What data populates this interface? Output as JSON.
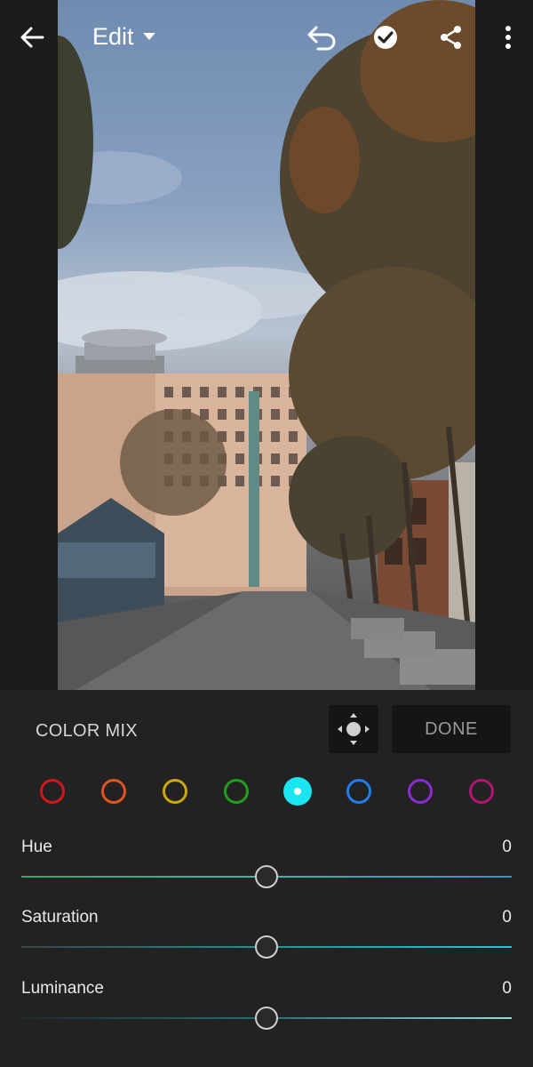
{
  "header": {
    "title": "Edit",
    "icons": {
      "back": "arrow-left-icon",
      "dropdown": "caret-down-icon",
      "undo": "undo-icon",
      "done": "checkmark-circle-icon",
      "share": "share-icon",
      "more": "more-vertical-icon"
    }
  },
  "photo": {
    "description_icon": "photo-canvas"
  },
  "panel": {
    "title": "COLOR MIX",
    "target_icon": "target-adjust-icon",
    "done_label": "DONE",
    "colors": [
      {
        "name": "red",
        "hex": "#d3161a",
        "selected": false
      },
      {
        "name": "orange",
        "hex": "#e2531e",
        "selected": false
      },
      {
        "name": "yellow",
        "hex": "#c9a90e",
        "selected": false
      },
      {
        "name": "green",
        "hex": "#1fa01c",
        "selected": false
      },
      {
        "name": "aqua",
        "hex": "#19e6f0",
        "selected": true
      },
      {
        "name": "blue",
        "hex": "#1d7ff0",
        "selected": false
      },
      {
        "name": "purple",
        "hex": "#8a2bd4",
        "selected": false
      },
      {
        "name": "magenta",
        "hex": "#b2156f",
        "selected": false
      }
    ],
    "sliders": [
      {
        "label": "Hue",
        "value": "0",
        "position": 0.5
      },
      {
        "label": "Saturation",
        "value": "0",
        "position": 0.5
      },
      {
        "label": "Luminance",
        "value": "0",
        "position": 0.5
      }
    ]
  }
}
